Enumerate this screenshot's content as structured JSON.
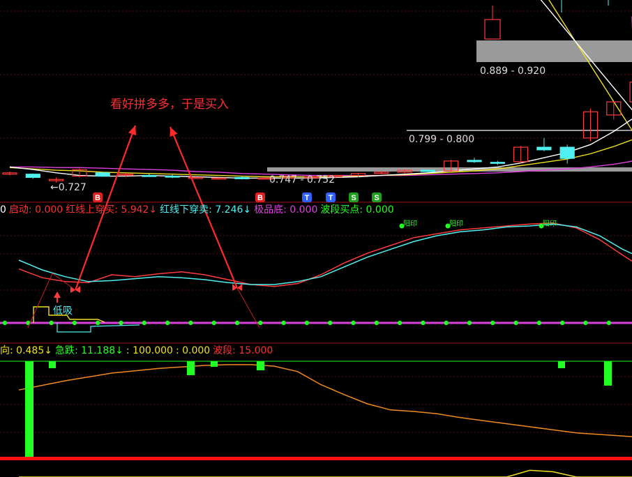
{
  "colors": {
    "background": "#000000",
    "up": "#ff3b3b",
    "down": "#4ff0f0",
    "ma_white": "#ffffff",
    "ma_yellow": "#f0e020",
    "ma_magenta": "#e040e0",
    "divider": "#a01010",
    "grid": "#5a1010",
    "annotation": "#ff2a2a",
    "green": "#22ff22",
    "orange": "#f08a20"
  },
  "annotation": {
    "text": "看好拼多多，于是买入"
  },
  "price_labels": [
    {
      "text": "0.889 - 0.920"
    },
    {
      "text": "0.799 - 0.800"
    },
    {
      "text": "0.747 - 0.752"
    },
    {
      "text": "←0.727"
    }
  ],
  "signals": {
    "markers": [
      {
        "label": "B",
        "color": "#e02020"
      },
      {
        "label": "B",
        "color": "#e02020"
      },
      {
        "label": "T",
        "color": "#3060ff"
      },
      {
        "label": "T",
        "color": "#3060ff"
      },
      {
        "label": "S",
        "color": "#20a020"
      },
      {
        "label": "S",
        "color": "#20a020"
      }
    ],
    "low_label": "低吸",
    "buy_flag_label": "阳印"
  },
  "indicator1": {
    "legend": [
      {
        "text": "0",
        "color": "#ffffff"
      },
      {
        "text": "启动: 0.000",
        "color": "#ff3030"
      },
      {
        "text": "红线上穿买: 5.942↓",
        "color": "#ff3030"
      },
      {
        "text": "红线下穿卖: 7.246↓",
        "color": "#4ff0f0"
      },
      {
        "text": "极品底: 0.000",
        "color": "#e040e0"
      },
      {
        "text": "波段买点: 0.000",
        "color": "#22ff22"
      }
    ]
  },
  "indicator2": {
    "legend": [
      {
        "text": "向: 0.485↓",
        "color": "#f0e020"
      },
      {
        "text": "急跌: 11.188↓",
        "color": "#22ff22"
      },
      {
        "text": ": 100.000",
        "color": "#f0e020"
      },
      {
        "text": ": 0.000",
        "color": "#f0e020"
      },
      {
        "text": "波段: 15.000",
        "color": "#ff3030"
      }
    ]
  },
  "chart_data": {
    "type": "candlestick",
    "candles": [
      {
        "o": 0.735,
        "h": 0.739,
        "l": 0.733,
        "c": 0.737
      },
      {
        "o": 0.735,
        "h": 0.736,
        "l": 0.728,
        "c": 0.73
      },
      {
        "o": 0.725,
        "h": 0.73,
        "l": 0.722,
        "c": 0.727
      },
      {
        "o": 0.732,
        "h": 0.744,
        "l": 0.73,
        "c": 0.742
      },
      {
        "o": 0.737,
        "h": 0.738,
        "l": 0.731,
        "c": 0.732
      },
      {
        "o": 0.734,
        "h": 0.737,
        "l": 0.731,
        "c": 0.735
      },
      {
        "o": 0.733,
        "h": 0.736,
        "l": 0.731,
        "c": 0.732
      },
      {
        "o": 0.732,
        "h": 0.734,
        "l": 0.729,
        "c": 0.731
      },
      {
        "o": 0.729,
        "h": 0.731,
        "l": 0.728,
        "c": 0.73
      },
      {
        "o": 0.728,
        "h": 0.73,
        "l": 0.727,
        "c": 0.729
      },
      {
        "o": 0.73,
        "h": 0.732,
        "l": 0.727,
        "c": 0.728
      },
      {
        "o": 0.728,
        "h": 0.73,
        "l": 0.727,
        "c": 0.729
      },
      {
        "o": 0.729,
        "h": 0.733,
        "l": 0.727,
        "c": 0.732
      },
      {
        "o": 0.73,
        "h": 0.732,
        "l": 0.728,
        "c": 0.731
      },
      {
        "o": 0.731,
        "h": 0.734,
        "l": 0.729,
        "c": 0.733
      },
      {
        "o": 0.733,
        "h": 0.737,
        "l": 0.731,
        "c": 0.736
      },
      {
        "o": 0.736,
        "h": 0.74,
        "l": 0.735,
        "c": 0.738
      },
      {
        "o": 0.738,
        "h": 0.742,
        "l": 0.736,
        "c": 0.741
      },
      {
        "o": 0.741,
        "h": 0.742,
        "l": 0.737,
        "c": 0.739
      },
      {
        "o": 0.74,
        "h": 0.757,
        "l": 0.739,
        "c": 0.755
      },
      {
        "o": 0.756,
        "h": 0.76,
        "l": 0.752,
        "c": 0.754
      },
      {
        "o": 0.753,
        "h": 0.755,
        "l": 0.749,
        "c": 0.752
      },
      {
        "o": 0.754,
        "h": 0.778,
        "l": 0.752,
        "c": 0.776
      },
      {
        "o": 0.776,
        "h": 0.79,
        "l": 0.77,
        "c": 0.772
      },
      {
        "o": 0.776,
        "h": 0.78,
        "l": 0.751,
        "c": 0.759
      },
      {
        "o": 0.79,
        "h": 0.835,
        "l": 0.785,
        "c": 0.83
      },
      {
        "o": 0.825,
        "h": 0.845,
        "l": 0.818,
        "c": 0.845
      },
      {
        "o": 0.845,
        "h": 0.88,
        "l": 0.843,
        "c": 0.875
      }
    ],
    "ma_white": [
      0.746,
      0.742,
      0.737,
      0.733,
      0.732,
      0.732,
      0.733,
      0.732,
      0.731,
      0.73,
      0.729,
      0.729,
      0.729,
      0.729,
      0.73,
      0.731,
      0.733,
      0.735,
      0.737,
      0.74,
      0.743,
      0.746,
      0.752,
      0.76,
      0.768,
      0.78,
      0.8,
      0.824
    ],
    "ma_yellow": [
      0.745,
      0.743,
      0.741,
      0.74,
      0.738,
      0.737,
      0.736,
      0.735,
      0.734,
      0.733,
      0.732,
      0.731,
      0.731,
      0.731,
      0.731,
      0.732,
      0.733,
      0.734,
      0.736,
      0.738,
      0.74,
      0.743,
      0.748,
      0.753,
      0.758,
      0.766,
      0.777,
      0.79
    ],
    "ma_magenta": [
      0.746,
      0.746,
      0.745,
      0.745,
      0.744,
      0.743,
      0.742,
      0.741,
      0.739,
      0.738,
      0.736,
      0.735,
      0.734,
      0.733,
      0.733,
      0.733,
      0.733,
      0.733,
      0.734,
      0.735,
      0.736,
      0.737,
      0.739,
      0.741,
      0.743,
      0.746,
      0.75,
      0.756
    ],
    "indicator1_red": [
      0.46,
      0.37,
      0.33,
      0.32,
      0.4,
      0.38,
      0.41,
      0.43,
      0.4,
      0.35,
      0.3,
      0.28,
      0.31,
      0.4,
      0.52,
      0.62,
      0.7,
      0.78,
      0.82,
      0.86,
      0.88,
      0.9,
      0.92,
      0.93,
      0.88,
      0.76,
      0.6,
      0.45
    ],
    "indicator1_cyan": [
      0.55,
      0.45,
      0.38,
      0.33,
      0.34,
      0.36,
      0.38,
      0.37,
      0.35,
      0.32,
      0.3,
      0.3,
      0.33,
      0.38,
      0.48,
      0.58,
      0.66,
      0.74,
      0.8,
      0.84,
      0.86,
      0.89,
      0.9,
      0.92,
      0.89,
      0.8,
      0.66,
      0.55
    ],
    "indicator2_orange": [
      0.28,
      0.34,
      0.4,
      0.45,
      0.5,
      0.53,
      0.56,
      0.58,
      0.6,
      0.61,
      0.61,
      0.59,
      0.52,
      0.35,
      0.22,
      0.1,
      0.02,
      0.0,
      -0.03,
      -0.08,
      -0.12,
      -0.16,
      -0.2,
      -0.24,
      -0.28,
      -0.3,
      -0.32,
      -0.34
    ],
    "indicator2_yellow": [
      -0.4,
      -0.44,
      -0.48,
      -0.52,
      -0.56,
      -0.6,
      -0.64,
      -0.68,
      -0.72,
      -0.76,
      -0.8,
      -0.84,
      -0.88,
      -0.92,
      -0.95,
      -0.98,
      -0.95,
      -0.8,
      -0.62,
      -0.42,
      -0.3,
      -0.12,
      0.08,
      0.05,
      -0.2,
      -0.5,
      -0.78,
      -0.92
    ],
    "ylim": [
      0.705,
      1.0
    ]
  }
}
